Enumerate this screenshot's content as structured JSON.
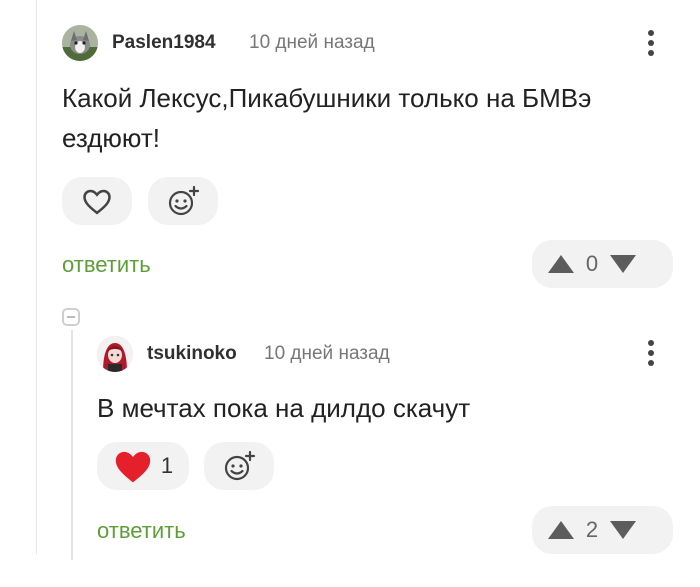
{
  "comments": [
    {
      "username": "Paslen1984",
      "time": "10 дней назад",
      "text": "Какой Лексус,Пикабушники только на БМВэ ездюют!",
      "reply_label": "ответить",
      "score": "0",
      "likes": "",
      "liked": false
    },
    {
      "username": "tsukinoko",
      "time": "10 дней назад",
      "text": "В мечтах пока на дилдо скачут",
      "reply_label": "ответить",
      "score": "2",
      "likes": "1",
      "liked": true
    }
  ],
  "colors": {
    "reply_link": "#5e9e3a",
    "heart_active": "#e5202b",
    "pill_bg": "#f2f2f2",
    "vote_arrow": "#5c5c5c"
  },
  "icons": [
    "heart-icon",
    "add-reaction-icon",
    "upvote-arrow-icon",
    "downvote-arrow-icon",
    "more-options-icon",
    "collapse-thread-icon"
  ]
}
